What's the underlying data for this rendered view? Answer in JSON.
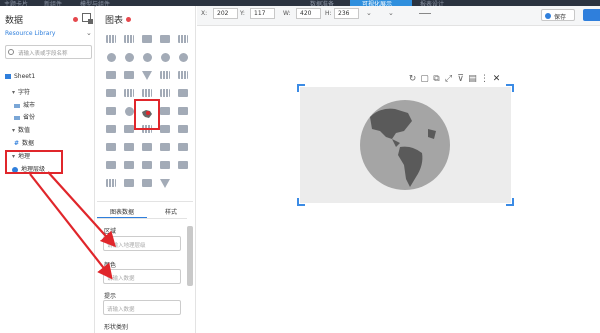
{
  "topbar": {
    "items": [
      "主题卡片",
      "新组件",
      "模型与组件"
    ],
    "tabs": [
      "数据准备",
      "可视化展示",
      "报表设计"
    ],
    "active_tab_index": 1
  },
  "data_panel": {
    "title": "数据",
    "resource_library": "Resource Library",
    "search_placeholder": "请输入表或字段名称",
    "tree": {
      "sheet": "Sheet1",
      "groups": [
        {
          "label": "字符",
          "fields": [
            "城市",
            "省份"
          ]
        },
        {
          "label": "数值",
          "fields": [
            "数据"
          ]
        },
        {
          "label": "地理",
          "fields": [
            "地理层级"
          ]
        }
      ]
    }
  },
  "chart_panel": {
    "title": "图表",
    "tabs": {
      "chart_data": "图表数据",
      "style": "样式"
    },
    "fields": [
      {
        "label": "区域",
        "placeholder": "请输入地理层级"
      },
      {
        "label": "颜色",
        "placeholder": "请输入数据"
      },
      {
        "label": "提示",
        "placeholder": "请输入数据"
      },
      {
        "label": "形状类别",
        "placeholder": ""
      }
    ]
  },
  "toolbar": {
    "x_label": "X:",
    "x": "202",
    "y_label": "Y:",
    "y": "117",
    "w_label": "W:",
    "w": "420",
    "h_label": "H:",
    "h": "236",
    "save_label": "保存"
  },
  "canvas": {
    "widget_tools": [
      "refresh-icon",
      "lock-icon",
      "copy-icon",
      "expand-icon",
      "filter-icon",
      "table-icon",
      "arrange-icon",
      "close-icon"
    ]
  },
  "colors": {
    "accent": "#2f7fdc",
    "highlight_red": "#e0262b",
    "globe_land": "#5a5a5a",
    "globe_sea": "#a5a5a5"
  }
}
